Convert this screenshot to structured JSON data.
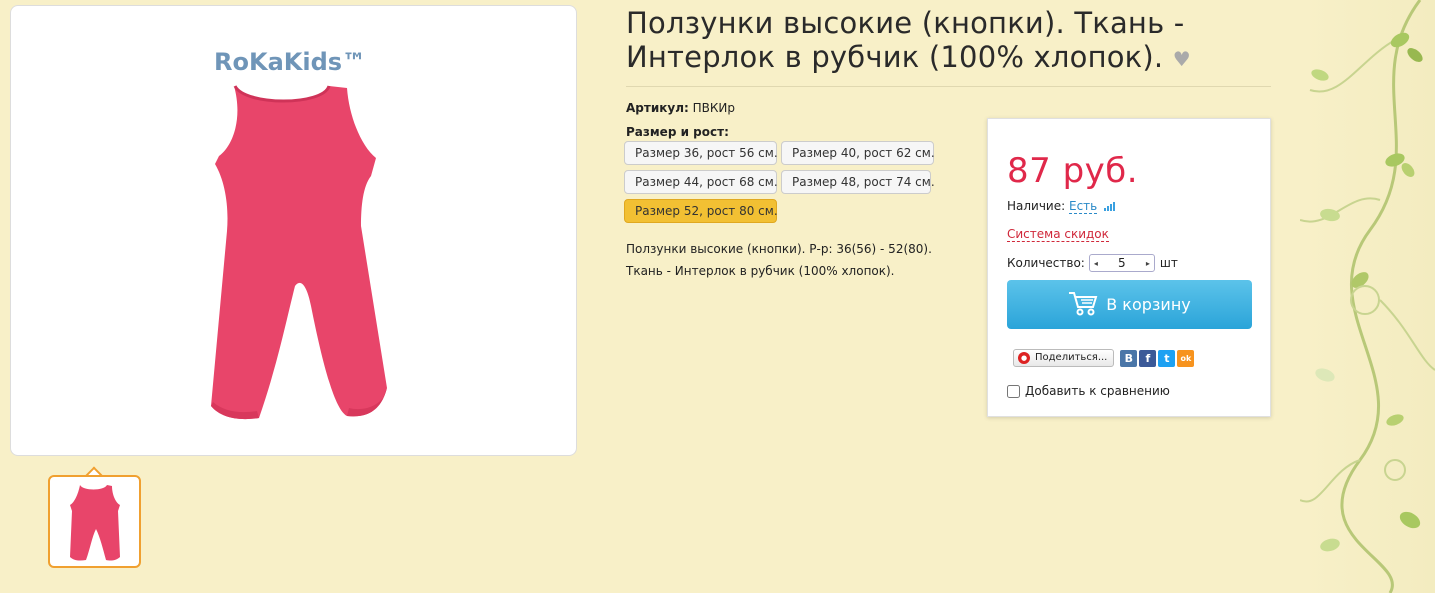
{
  "product": {
    "title": "Ползунки высокие (кнопки). Ткань - Интерлок в рубчик (100% хлопок).",
    "brand_logo": "RoKaKids™",
    "article_label": "Артикул:",
    "article_value": "ПВКИр",
    "size_label": "Размер и рост:",
    "sizes": [
      {
        "label": "Размер 36, рост 56 см."
      },
      {
        "label": "Размер 40, рост 62 см."
      },
      {
        "label": "Размер 44, рост 68 см."
      },
      {
        "label": "Размер 48, рост 74 см."
      },
      {
        "label": "Размер 52, рост 80 см."
      }
    ],
    "selected_size": "Размер 52, рост 80 см.",
    "description_1": "Ползунки высокие (кнопки). Р-р: 36(56) - 52(80).",
    "description_2": "Ткань - Интерлок в рубчик (100% хлопок)."
  },
  "buy_box": {
    "price": "87 руб.",
    "availability_label": "Наличие:",
    "availability_value": "Есть",
    "discount_link": "Система скидок",
    "quantity_label": "Количество:",
    "quantity_value": "5",
    "quantity_unit": "шт",
    "cart_button": "В корзину",
    "share_button": "Поделиться...",
    "social": [
      {
        "name": "vk",
        "glyph": "В",
        "color": "#4a76a8"
      },
      {
        "name": "facebook",
        "glyph": "f",
        "color": "#3b5998"
      },
      {
        "name": "twitter",
        "glyph": "t",
        "color": "#1da1f2"
      },
      {
        "name": "odnoklassniki",
        "glyph": "ok",
        "color": "#f7931e"
      }
    ],
    "compare_label": "Добавить к сравнению"
  },
  "colors": {
    "background": "#f8f0c8",
    "price": "#e0284a",
    "cart_button": "#2aa4d9",
    "selected_size": "#f2c033",
    "product_pink": "#e8456a"
  }
}
